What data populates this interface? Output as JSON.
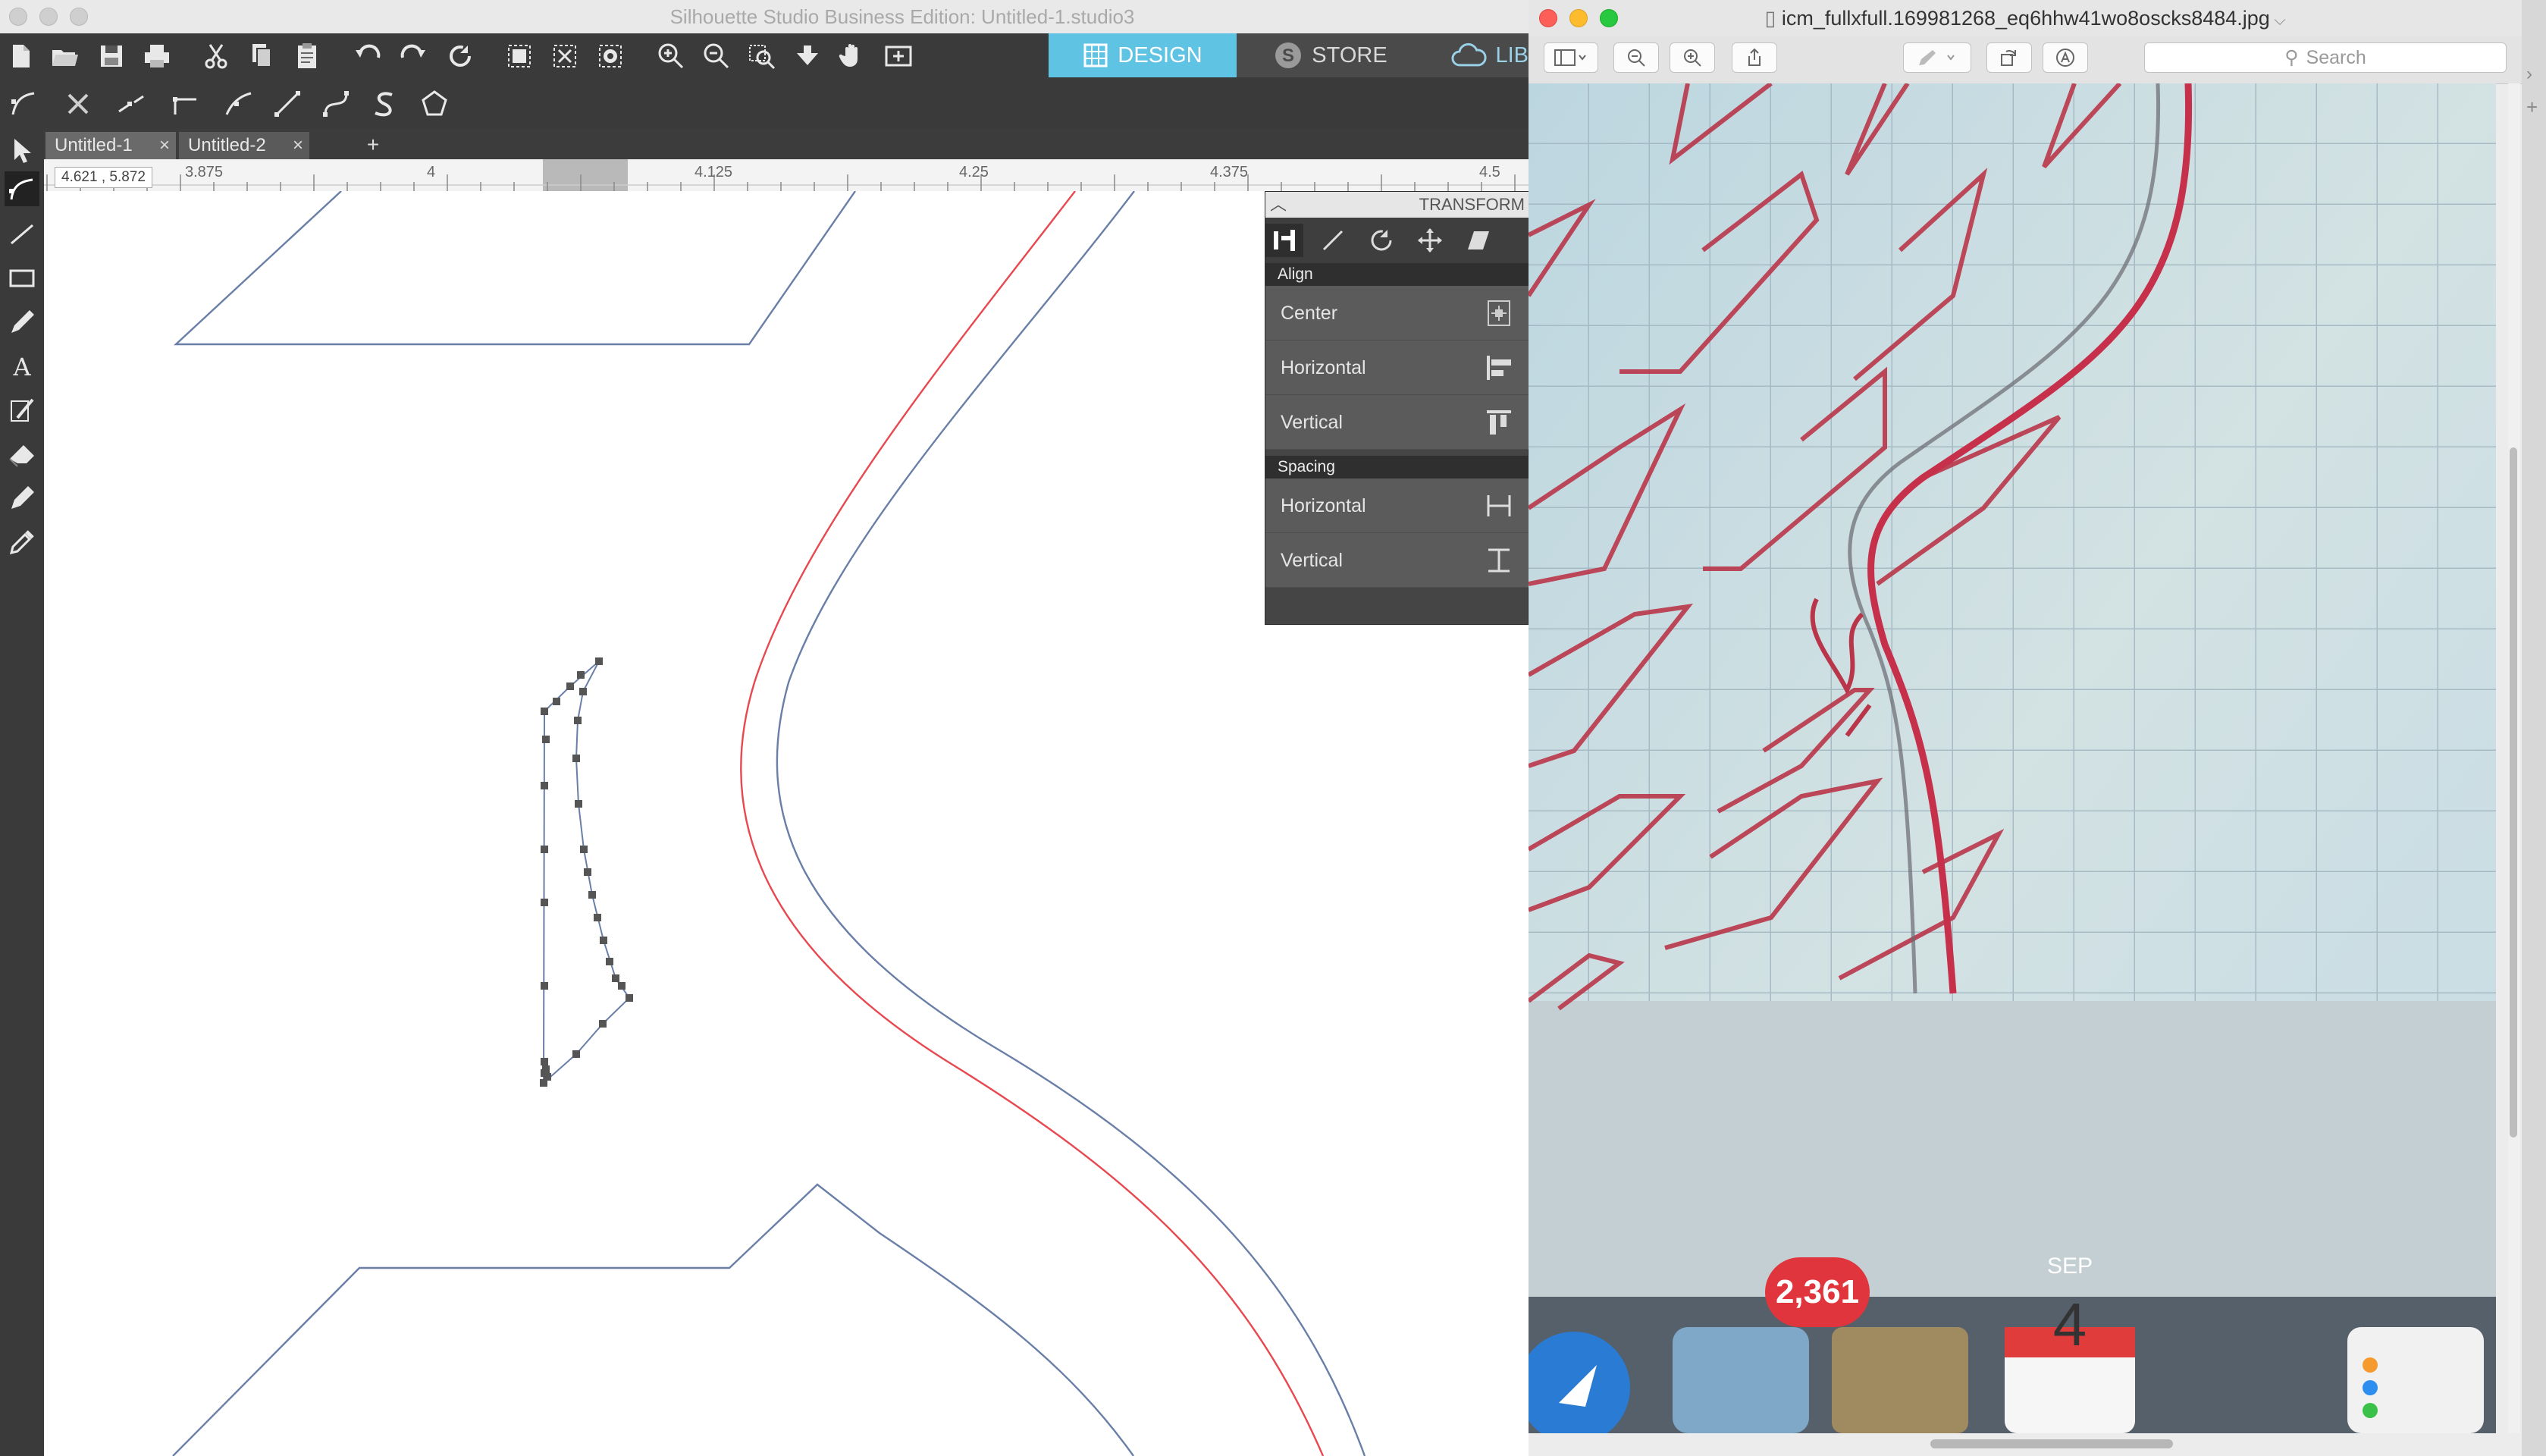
{
  "silhouette": {
    "title": "Silhouette Studio Business Edition: Untitled-1.studio3",
    "nav": {
      "design": "DESIGN",
      "store": "STORE",
      "library": "LIB"
    },
    "tabs": [
      {
        "label": "Untitled-1",
        "close": "×"
      },
      {
        "label": "Untitled-2",
        "close": "×"
      }
    ],
    "tab_add": "+",
    "ruler_ticks": [
      "3.875",
      "4",
      "4.125",
      "4.25",
      "4.375",
      "4.5"
    ],
    "coordinates": "4.621 , 5.872",
    "transform": {
      "title": "TRANSFORM",
      "align_header": "Align",
      "align_items": [
        "Center",
        "Horizontal",
        "Vertical"
      ],
      "spacing_header": "Spacing",
      "spacing_items": [
        "Horizontal",
        "Vertical"
      ]
    },
    "colors": {
      "accent": "#5fc3e4",
      "cut_line_red": "#e8484f",
      "shape_line_blue": "#6a7fa8"
    }
  },
  "preview": {
    "filename": "icm_fullxfull.169981268_eq6hhw41wo8oscks8484.jpg",
    "search_placeholder": "Search",
    "dock": {
      "mail_badge": "2,361",
      "calendar_month": "SEP",
      "calendar_day": "4"
    }
  }
}
